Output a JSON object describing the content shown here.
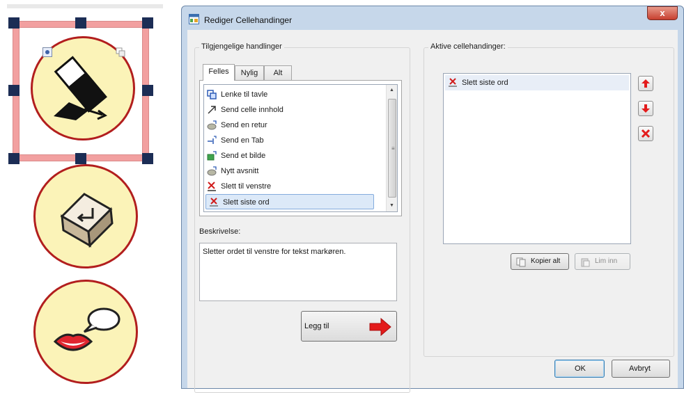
{
  "dialog": {
    "title": "Rediger Cellehandinger",
    "close_glyph": "x",
    "available_group": {
      "label": "Tilgjengelige handlinger",
      "tabs": [
        {
          "label": "Felles",
          "active": true
        },
        {
          "label": "Nylig",
          "active": false
        },
        {
          "label": "Alt",
          "active": false
        }
      ],
      "items": [
        {
          "label": "Lenke til tavle",
          "icon": "link-board-icon",
          "selected": false
        },
        {
          "label": "Send celle innhold",
          "icon": "send-arrow-icon",
          "selected": false
        },
        {
          "label": "Send en retur",
          "icon": "send-return-icon",
          "selected": false
        },
        {
          "label": "Send en Tab",
          "icon": "send-tab-icon",
          "selected": false
        },
        {
          "label": "Send et bilde",
          "icon": "send-image-icon",
          "selected": false
        },
        {
          "label": "Nytt avsnitt",
          "icon": "new-paragraph-icon",
          "selected": false
        },
        {
          "label": "Slett til venstre",
          "icon": "delete-left-icon",
          "selected": false
        },
        {
          "label": "Slett siste ord",
          "icon": "delete-word-icon",
          "selected": true
        }
      ],
      "description_label": "Beskrivelse:",
      "description_text": "Sletter ordet til venstre for tekst markøren.",
      "add_button_label": "Legg til"
    },
    "active_group": {
      "label": "Aktive cellehandinger:",
      "items": [
        {
          "label": "Slett siste ord",
          "icon": "delete-word-icon"
        }
      ],
      "copy_all_label": "Kopier alt",
      "paste_label": "Lim inn"
    },
    "ok_label": "OK",
    "cancel_label": "Avbryt"
  },
  "colors": {
    "cell_fill": "#fbf3b8",
    "cell_border": "#b21e1e",
    "selection_frame": "#f2a0a0",
    "selection_handle": "#1c2d55",
    "red_arrow": "#e31b1b",
    "list_selection": "#dce9f8"
  },
  "symbols": [
    {
      "icon": "eraser-icon",
      "selected": true
    },
    {
      "icon": "enter-key-icon",
      "selected": false
    },
    {
      "icon": "speaking-mouth-icon",
      "selected": false
    }
  ]
}
